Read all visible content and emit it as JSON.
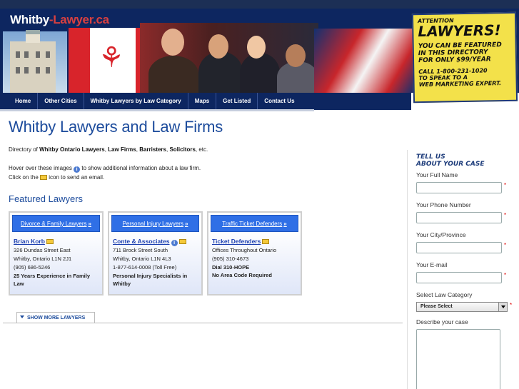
{
  "header": {
    "logo_part1": "Whitby",
    "logo_part2": "-Lawyer.ca"
  },
  "ad": {
    "attention": "ATTENTION",
    "big": "LAWYERS!",
    "line1": "YOU CAN BE FEATURED",
    "line2": "IN THIS DIRECTORY",
    "line3": "FOR ONLY $99/YEAR",
    "call1": "CALL 1-800-231-1020",
    "call2": "TO SPEAK TO A",
    "call3": "WEB MARKETING EXPERT."
  },
  "nav": [
    "Home",
    "Other Cities",
    "Whitby Lawyers by Law Category",
    "Maps",
    "Get Listed",
    "Contact Us"
  ],
  "main": {
    "title": "Whitby Lawyers and Law Firms",
    "intro_pre": "Directory of ",
    "intro_b1": "Whitby Ontario Lawyers",
    "intro_sep1": ", ",
    "intro_b2": "Law Firms",
    "intro_sep2": ", ",
    "intro_b3": "Barristers",
    "intro_sep3": ", ",
    "intro_b4": "Solicitors",
    "intro_post": ", etc.",
    "hint1_pre": "Hover over these images ",
    "hint1_post": " to show additional information about a law firm.",
    "hint2_pre": "Click on the ",
    "hint2_post": " icon to send an email.",
    "featured_title": "Featured Lawyers",
    "show_more": "SHOW MORE LAWYERS"
  },
  "cards": [
    {
      "category": "Divorce & Family Lawyers",
      "name": "Brian Korb",
      "line1": "326 Dundas Street East",
      "line2": "Whitby, Ontario L1N 2J1",
      "line3": "(905) 686-5246",
      "note": "25 Years Experience in Family Law"
    },
    {
      "category": "Personal Injury Lawyers",
      "name": "Conte & Associates",
      "line1": "711 Brock Street South",
      "line2": "Whitby, Ontario L1N 4L3",
      "line3": "1-877-614-0008 (Toll Free)",
      "note": "Personal Injury Specialists in Whitby"
    },
    {
      "category": "Traffic Ticket Defenders",
      "name": "Ticket Defenders",
      "line1": "Offices Throughout Ontario",
      "line2": "(905) 310-4673",
      "line3": "Dial 310-HOPE",
      "note": "No Area Code Required"
    }
  ],
  "sidebar": {
    "title1": "TELL US",
    "title2": "ABOUT YOUR CASE",
    "full_name": "Your Full Name",
    "phone": "Your Phone Number",
    "city": "Your City/Province",
    "email": "Your E-mail",
    "category": "Select Law Category",
    "category_value": "Please Select",
    "describe": "Describe your case",
    "req": "*"
  },
  "icons": {
    "info": "info-icon",
    "mail": "envelope-icon",
    "arrows": "»"
  }
}
